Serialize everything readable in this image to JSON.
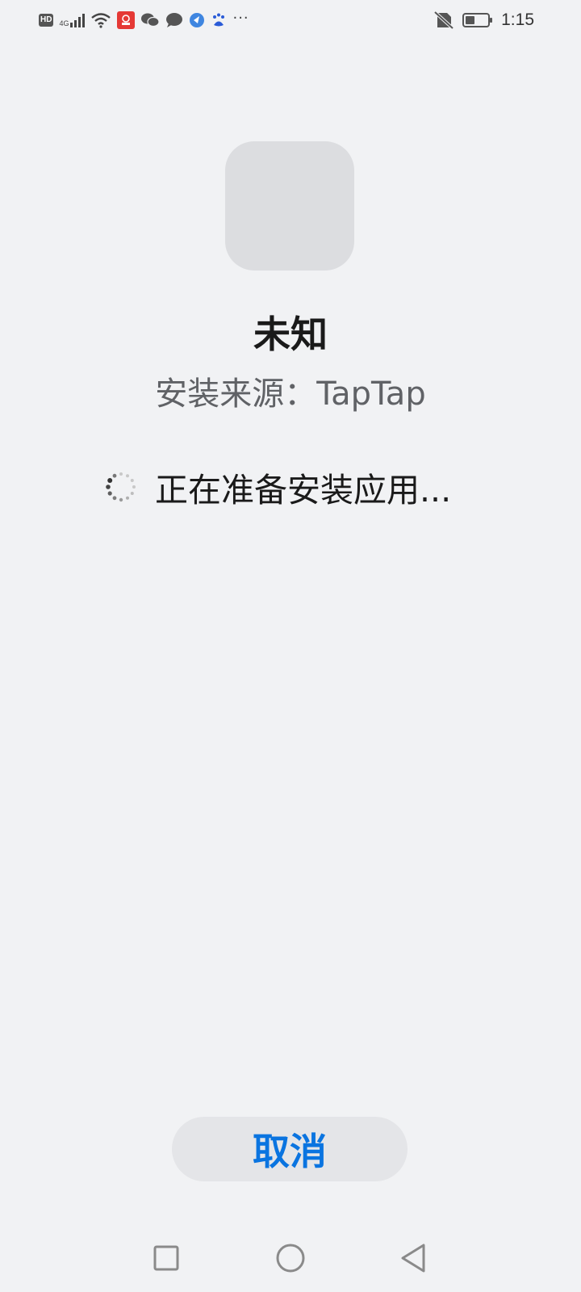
{
  "status_bar": {
    "hd_label": "HD",
    "network_label": "4G",
    "time": "1:15",
    "notification_icons": [
      "hd-icon",
      "signal-icon",
      "wifi-icon",
      "red-app-icon",
      "wechat-icon",
      "message-icon",
      "browser-icon",
      "baidu-icon",
      "more-icon"
    ],
    "right_icons": [
      "no-sim-icon",
      "battery-icon"
    ]
  },
  "app": {
    "name": "未知",
    "source": "安装来源：TapTap",
    "icon_color": "#dcdde0"
  },
  "progress": {
    "text": "正在准备安装应用..."
  },
  "actions": {
    "cancel_label": "取消",
    "accent_color": "#0a74e0"
  },
  "nav_bar": {
    "buttons": [
      "recent-apps-icon",
      "home-icon",
      "back-icon"
    ]
  }
}
